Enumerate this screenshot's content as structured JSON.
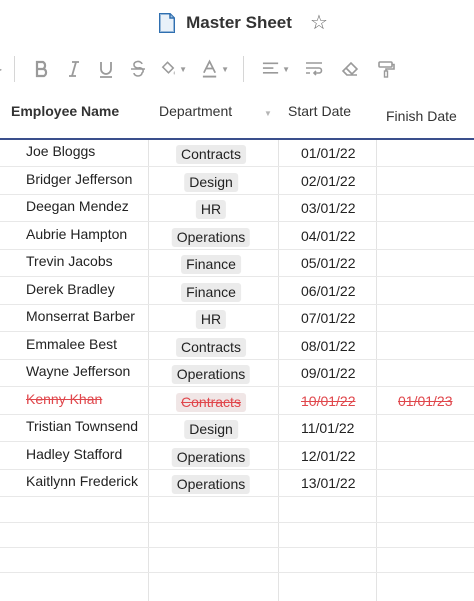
{
  "sheet": {
    "title": "Master Sheet"
  },
  "toolbar": {
    "tools": [
      "bold-icon",
      "italic-icon",
      "underline-icon",
      "strikethrough-icon",
      "fill-color-icon",
      "text-color-icon",
      "align-icon",
      "wrap-icon",
      "clear-format-icon",
      "paint-format-icon"
    ]
  },
  "columns": {
    "name": "Employee Name",
    "department": "Department",
    "start": "Start Date",
    "finish": "Finish Date"
  },
  "rows": [
    {
      "name": "Joe Bloggs",
      "department": "Contracts",
      "start": "01/01/22",
      "finish": ""
    },
    {
      "name": "Bridger Jefferson",
      "department": "Design",
      "start": "02/01/22",
      "finish": ""
    },
    {
      "name": "Deegan Mendez",
      "department": "HR",
      "start": "03/01/22",
      "finish": ""
    },
    {
      "name": "Aubrie Hampton",
      "department": "Operations",
      "start": "04/01/22",
      "finish": ""
    },
    {
      "name": "Trevin Jacobs",
      "department": "Finance",
      "start": "05/01/22",
      "finish": ""
    },
    {
      "name": "Derek Bradley",
      "department": "Finance",
      "start": "06/01/22",
      "finish": ""
    },
    {
      "name": "Monserrat Barber",
      "department": "HR",
      "start": "07/01/22",
      "finish": ""
    },
    {
      "name": "Emmalee Best",
      "department": "Contracts",
      "start": "08/01/22",
      "finish": ""
    },
    {
      "name": "Wayne Jefferson",
      "department": "Operations",
      "start": "09/01/22",
      "finish": ""
    },
    {
      "name": "Kenny Khan",
      "department": "Contracts",
      "start": "10/01/22",
      "finish": "01/01/23",
      "deleted": true
    },
    {
      "name": "Tristian Townsend",
      "department": "Design",
      "start": "11/01/22",
      "finish": ""
    },
    {
      "name": "Hadley Stafford",
      "department": "Operations",
      "start": "12/01/22",
      "finish": ""
    },
    {
      "name": "Kaitlynn Frederick",
      "department": "Operations",
      "start": "13/01/22",
      "finish": ""
    }
  ],
  "colors": {
    "accent": "#3a4f8c",
    "deleted": "#e0474c",
    "pill": "#ebebeb",
    "doc_icon": "#2f6fb0"
  }
}
